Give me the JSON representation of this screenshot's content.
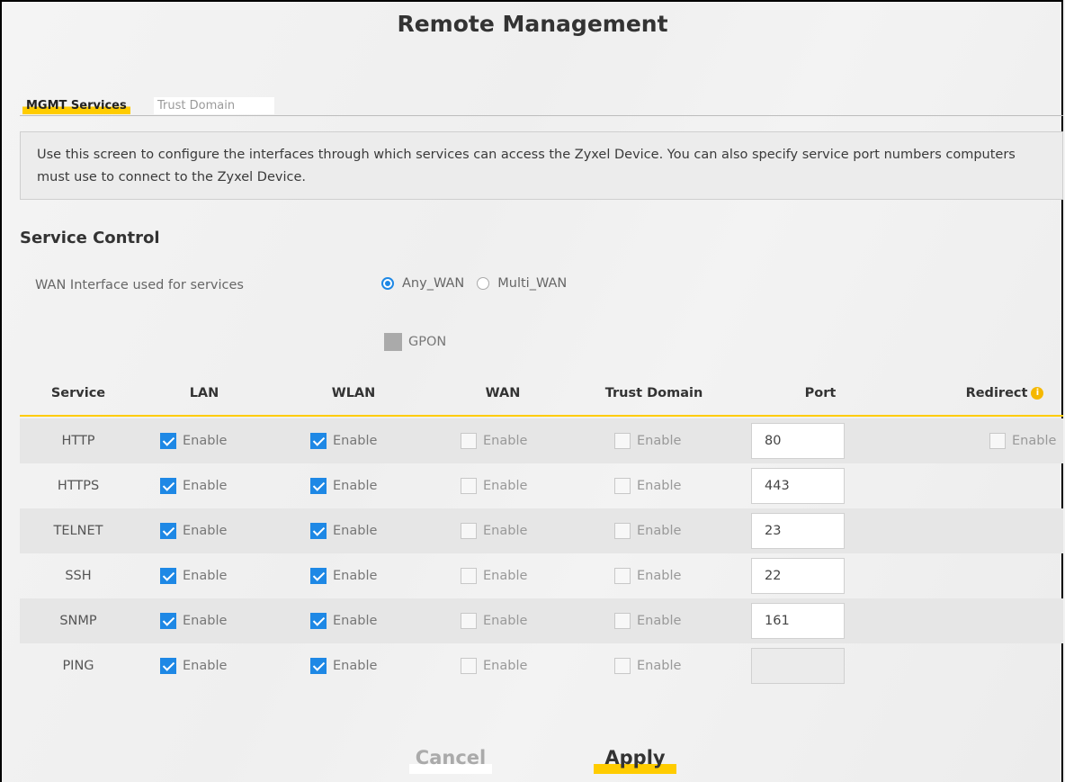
{
  "page": {
    "title": "Remote Management"
  },
  "tabs": [
    {
      "label": "MGMT Services",
      "active": true
    },
    {
      "label": "Trust Domain",
      "active": false
    }
  ],
  "description": "Use this screen to configure the interfaces through which services can access the Zyxel Device. You can also specify service port numbers computers must use to connect to the Zyxel Device.",
  "service_control": {
    "title": "Service Control",
    "wan_label": "WAN Interface used for services",
    "options": [
      {
        "label": "Any_WAN",
        "selected": true
      },
      {
        "label": "Multi_WAN",
        "selected": false
      }
    ],
    "gpon_label": "GPON"
  },
  "table": {
    "headers": [
      "Service",
      "LAN",
      "WLAN",
      "WAN",
      "Trust Domain",
      "Port",
      "Redirect"
    ],
    "enable_label": "Enable",
    "rows": [
      {
        "service": "HTTP",
        "lan": true,
        "wlan": true,
        "wan": false,
        "trust": false,
        "port": "80",
        "redirect": false
      },
      {
        "service": "HTTPS",
        "lan": true,
        "wlan": true,
        "wan": false,
        "trust": false,
        "port": "443"
      },
      {
        "service": "TELNET",
        "lan": true,
        "wlan": true,
        "wan": false,
        "trust": false,
        "port": "23"
      },
      {
        "service": "SSH",
        "lan": true,
        "wlan": true,
        "wan": false,
        "trust": false,
        "port": "22"
      },
      {
        "service": "SNMP",
        "lan": true,
        "wlan": true,
        "wan": false,
        "trust": false,
        "port": "161"
      },
      {
        "service": "PING",
        "lan": true,
        "wlan": true,
        "wan": false,
        "trust": false,
        "port": "",
        "port_disabled": true
      }
    ]
  },
  "buttons": {
    "cancel": "Cancel",
    "apply": "Apply"
  },
  "colors": {
    "accent": "#ffcc00",
    "check": "#1e88e5",
    "info_icon": "#f5b800"
  }
}
